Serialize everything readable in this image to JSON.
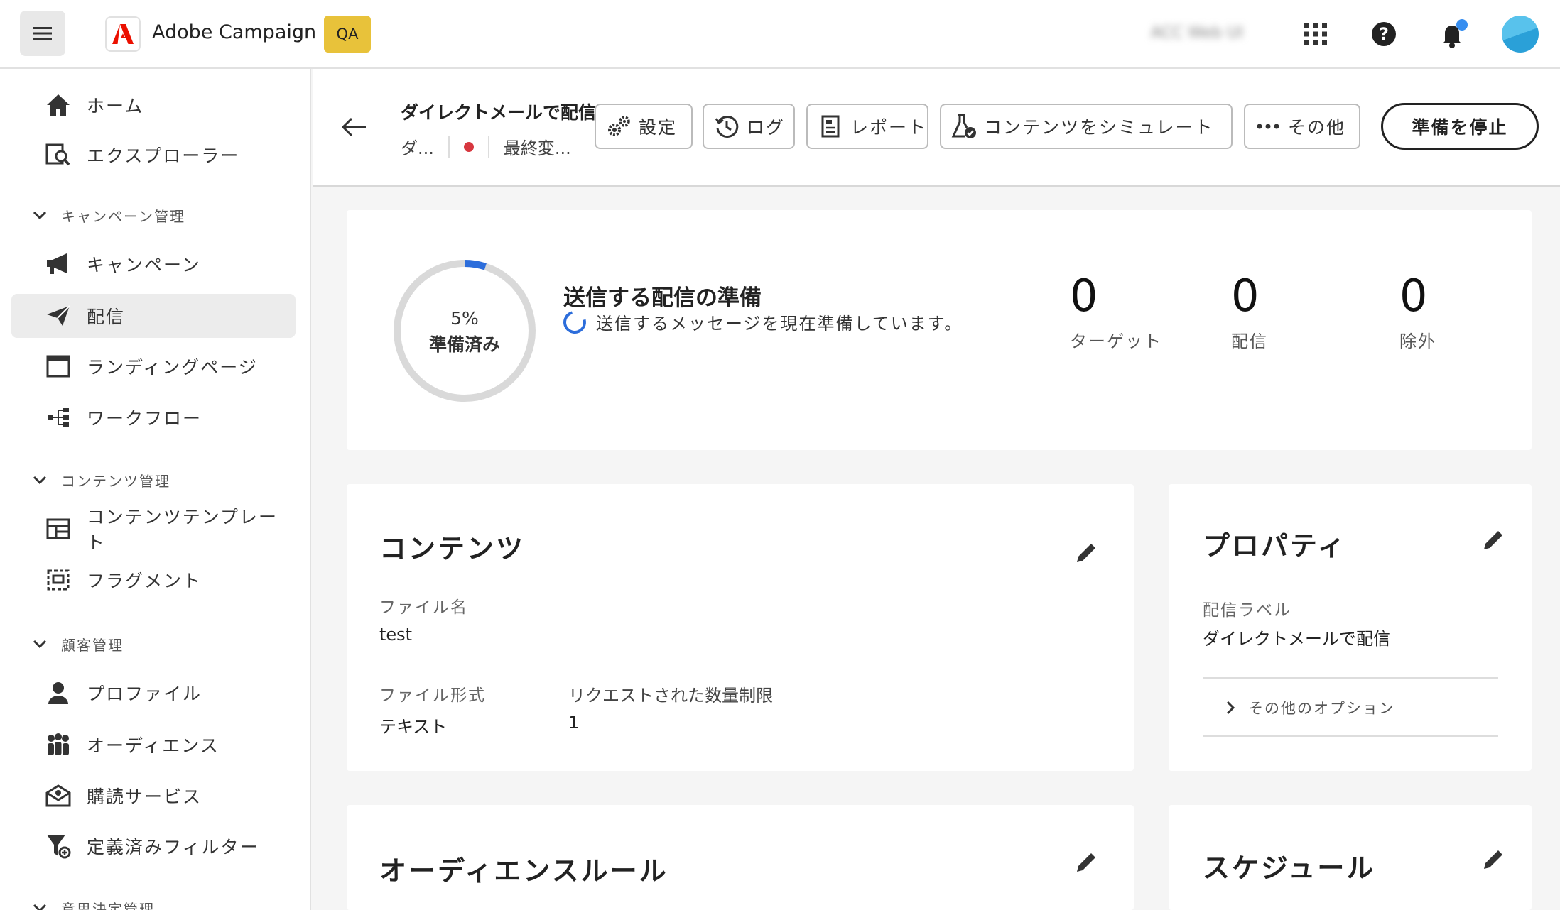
{
  "topbar": {
    "app_name": "Adobe Campaign",
    "env_badge": "QA",
    "org_name": "ACC Web UI",
    "icons": [
      "apps-grid-icon",
      "help-icon",
      "bell-icon",
      "avatar"
    ],
    "accent": "#e8c23a"
  },
  "sidebar": {
    "items": [
      {
        "label": "ホーム",
        "icon": "home-icon"
      },
      {
        "label": "エクスプローラー",
        "icon": "explorer-icon"
      },
      {
        "label": "キャンペーン",
        "icon": "megaphone-icon"
      },
      {
        "label": "配信",
        "icon": "send-icon",
        "active": true
      },
      {
        "label": "ランディングページ",
        "icon": "landing-page-icon"
      },
      {
        "label": "ワークフロー",
        "icon": "workflow-icon"
      },
      {
        "label": "コンテンツテンプレート",
        "icon": "template-icon"
      },
      {
        "label": "フラグメント",
        "icon": "fragment-icon"
      },
      {
        "label": "プロファイル",
        "icon": "profile-icon"
      },
      {
        "label": "オーディエンス",
        "icon": "audience-icon"
      },
      {
        "label": "購読サービス",
        "icon": "subscription-icon"
      },
      {
        "label": "定義済みフィルター",
        "icon": "filter-icon"
      }
    ],
    "sections": [
      "キャンペーン管理",
      "コンテンツ管理",
      "顧客管理",
      "意思決定管理"
    ]
  },
  "header": {
    "title": "ダイレクトメールで配信",
    "meta_short": "ダ...",
    "meta_modified": "最終変...",
    "status_color": "#d7373f",
    "buttons": {
      "settings": "設定",
      "log": "ログ",
      "report": "レポート",
      "simulate": "コンテンツをシミュレート",
      "more": "その他"
    },
    "stop_button": "準備を停止"
  },
  "summary": {
    "progress_percent": 5,
    "progress_text": "5%",
    "progress_label": "準備済み",
    "title": "送信する配信の準備",
    "status": "送信するメッセージを現在準備しています。",
    "stats": [
      {
        "value": "0",
        "label": "ターゲット"
      },
      {
        "value": "0",
        "label": "配信"
      },
      {
        "value": "0",
        "label": "除外"
      }
    ]
  },
  "content_card": {
    "title": "コンテンツ",
    "file_name_label": "ファイル名",
    "file_name_value": "test",
    "file_format_label": "ファイル形式",
    "file_format_value": "テキスト",
    "quantity_label": "リクエストされた数量制限",
    "quantity_value": "1"
  },
  "properties_card": {
    "title": "プロパティ",
    "label_label": "配信ラベル",
    "label_value": "ダイレクトメールで配信",
    "more_options": "その他のオプション"
  },
  "audience_card": {
    "title": "オーディエンスルール"
  },
  "schedule_card": {
    "title": "スケジュール"
  }
}
